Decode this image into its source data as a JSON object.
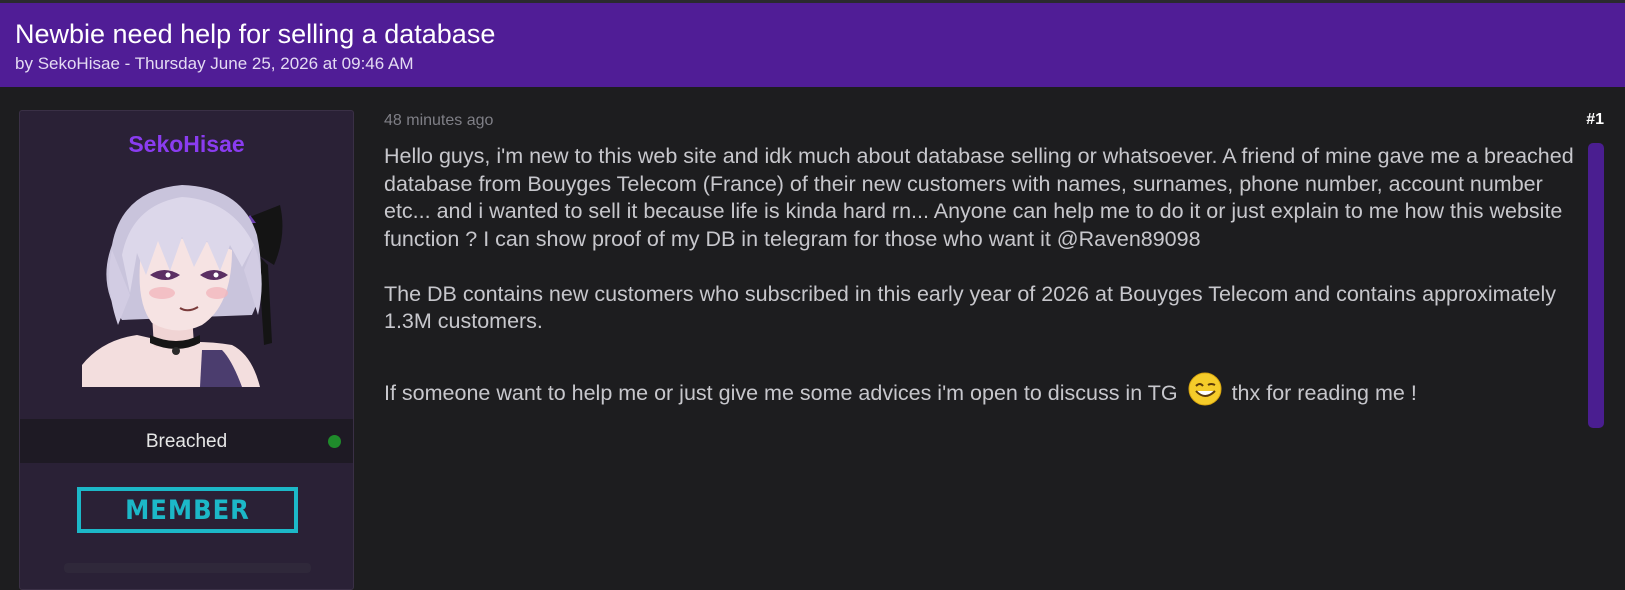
{
  "thread": {
    "title": "Newbie need help for selling a database",
    "meta_prefix": "by ",
    "author": "SekoHisae",
    "meta_suffix": " - Thursday June 25, 2026 at 09:46 AM"
  },
  "user": {
    "username": "SekoHisae",
    "rank": "Breached",
    "badge": "MEMBER",
    "online_status_color": "#1f8b2b"
  },
  "post": {
    "time": "48 minutes ago",
    "number": "#1",
    "paragraph1": "Hello guys, i'm new to this web site and idk much about database selling or whatsoever. A friend of mine gave me a breached database from Bouyges Telecom (France) of their new customers with names, surnames, phone number, account number etc... and i wanted to sell it because life is kinda hard rn... Anyone can help me to do it or just explain to me how this website function ? I can show proof of my DB in telegram for those who want it @Raven89098",
    "paragraph2": "The DB contains new customers who subscribed in this early year of 2026 at Bouyges Telecom and contains approximately 1.3M customers.",
    "paragraph3_before": "If someone want to help me or just give me some advices i'm open to discuss in TG",
    "emoji": "wink-smile-emoji",
    "paragraph3_after": "thx for reading me !"
  },
  "colors": {
    "header_bg": "#501d96",
    "page_bg": "#1d1d1f",
    "username": "#8a3cf0",
    "badge": "#1cb8c8",
    "scroll_track": "#4a1e90"
  }
}
